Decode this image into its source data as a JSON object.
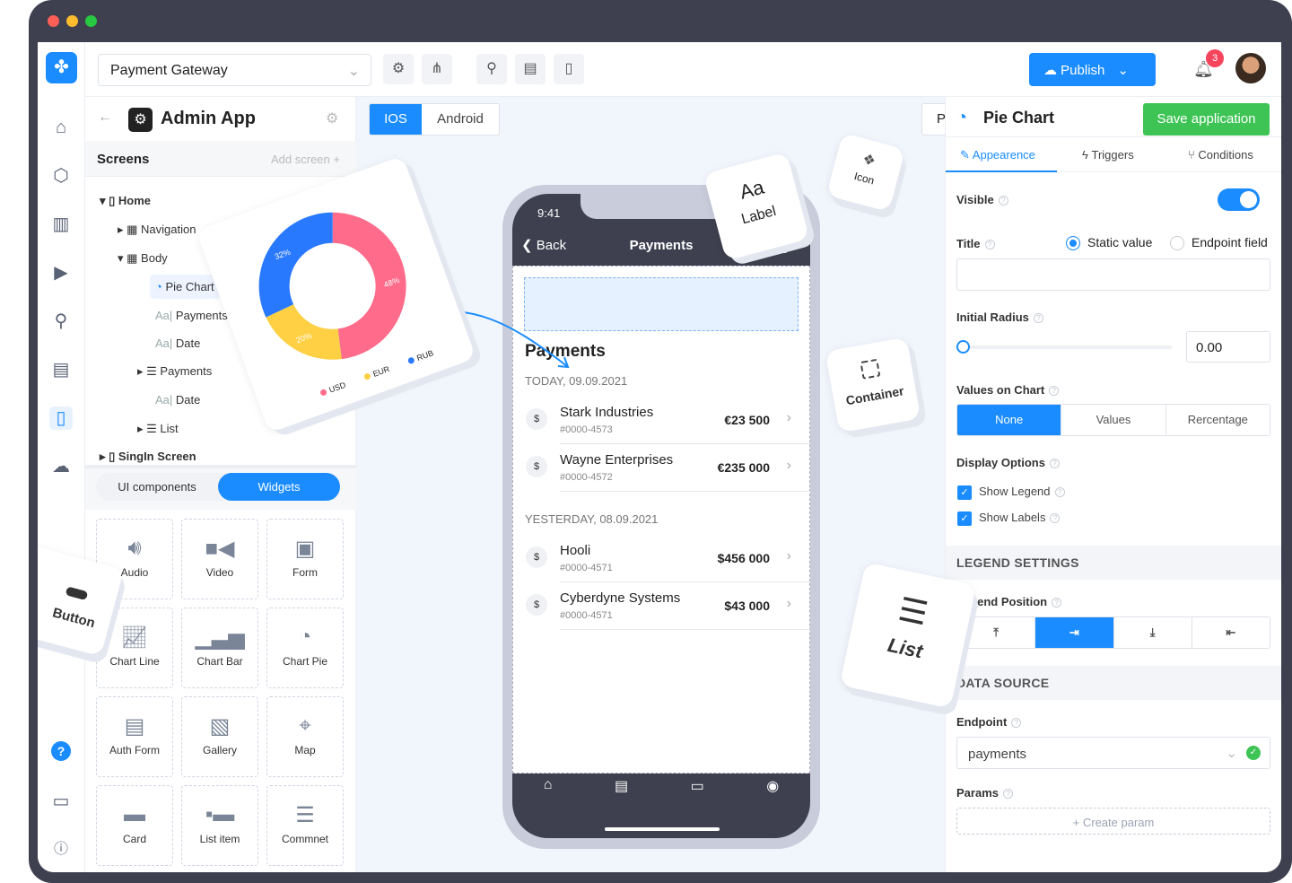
{
  "topbar": {
    "project": "Payment Gateway",
    "publish": "Publish",
    "notif_count": "3"
  },
  "left": {
    "app_title": "Admin App",
    "screens_label": "Screens",
    "add_screen": "Add screen",
    "tree": [
      {
        "label": "Home"
      },
      {
        "label": "Navigation"
      },
      {
        "label": "Body"
      },
      {
        "label": "Pie Chart"
      },
      {
        "label": "Payments"
      },
      {
        "label": "Date"
      },
      {
        "label": "Payments"
      },
      {
        "label": "Date"
      },
      {
        "label": "List"
      },
      {
        "label": "SingIn Screen"
      }
    ],
    "tabs": [
      "UI components",
      "Widgets"
    ],
    "widgets": [
      {
        "label": "Audio",
        "icon": "audio-icon"
      },
      {
        "label": "Video",
        "icon": "video-icon"
      },
      {
        "label": "Form",
        "icon": "form-icon"
      },
      {
        "label": "Chart Line",
        "icon": "chart-line-icon"
      },
      {
        "label": "Chart Bar",
        "icon": "chart-bar-icon"
      },
      {
        "label": "Chart Pie",
        "icon": "chart-pie-icon"
      },
      {
        "label": "Auth Form",
        "icon": "auth-form-icon"
      },
      {
        "label": "Gallery",
        "icon": "gallery-icon"
      },
      {
        "label": "Map",
        "icon": "map-icon"
      },
      {
        "label": "Card",
        "icon": "card-icon"
      },
      {
        "label": "List item",
        "icon": "list-item-icon"
      },
      {
        "label": "Commnet",
        "icon": "comment-icon"
      }
    ]
  },
  "canvas": {
    "platforms": [
      "IOS",
      "Android"
    ],
    "push": "Push-notification",
    "save": "Save application",
    "floating": {
      "label_aa": "Aa",
      "label": "Label",
      "icon": "Icon",
      "container": "Container",
      "list": "List",
      "button": "Button"
    },
    "pie": {
      "slices": [
        {
          "name": "USD",
          "value": 48,
          "label": "48%",
          "color": "#ff6b8a"
        },
        {
          "name": "EUR",
          "value": 20,
          "label": "20%",
          "color": "#ffd044"
        },
        {
          "name": "RUB",
          "value": 32,
          "label": "32%",
          "color": "#2979ff"
        }
      ]
    },
    "phone": {
      "time": "9:41",
      "back": "Back",
      "nav_title": "Payments",
      "heading": "Payments",
      "groups": [
        {
          "date": "TODAY, 09.09.2021",
          "items": [
            {
              "name": "Stark Industries",
              "id": "#0000-4573",
              "amount": "€23 500"
            },
            {
              "name": "Wayne Enterprises",
              "id": "#0000-4572",
              "amount": "€235 000"
            }
          ]
        },
        {
          "date": "YESTERDAY, 08.09.2021",
          "items": [
            {
              "name": "Hooli",
              "id": "#0000-4571",
              "amount": "$456 000"
            },
            {
              "name": "Cyberdyne Systems",
              "id": "#0000-4571",
              "amount": "$43 000"
            }
          ]
        }
      ]
    }
  },
  "right": {
    "title": "Pie Chart",
    "tabs": [
      "Appearence",
      "Triggers",
      "Conditions"
    ],
    "visible": "Visible",
    "visible_on": true,
    "title_label": "Title",
    "radio": [
      "Static value",
      "Endpoint field"
    ],
    "radius_label": "Initial Radius",
    "radius_value": "0.00",
    "values_label": "Values on Chart",
    "values_opts": [
      "None",
      "Values",
      "Rercentage"
    ],
    "display_label": "Display Options",
    "show_legend": "Show Legend",
    "show_labels": "Show Labels",
    "legend_section": "LEGEND SETTINGS",
    "legend_pos": "Legend Position",
    "legend_opts": [
      "top",
      "right",
      "bottom",
      "left"
    ],
    "ds_section": "DATA SOURCE",
    "endpoint_label": "Endpoint",
    "endpoint_value": "payments",
    "params_label": "Params",
    "create_param": "+ Create param"
  },
  "colors": {
    "accent": "#1a8cff",
    "green": "#3ec455",
    "frame": "#3e404f"
  }
}
